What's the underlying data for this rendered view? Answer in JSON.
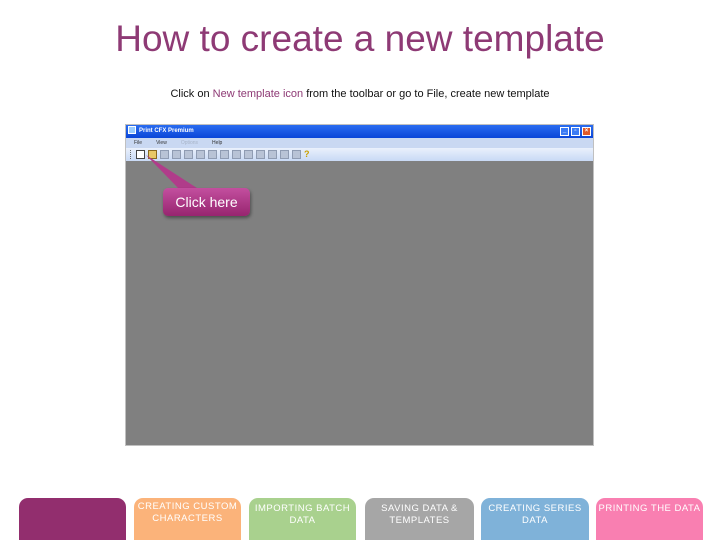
{
  "title": "How to create a new template",
  "subtitle": {
    "prefix": "Click on ",
    "highlight": "New template icon",
    "suffix": " from the toolbar or go to File, create new template"
  },
  "app_window": {
    "title": "Print CFX Premium",
    "menu": [
      "File",
      "View",
      "Options",
      "Help"
    ],
    "window_buttons": [
      "minimize",
      "restore",
      "close"
    ],
    "toolbar_icons": [
      "new-template-icon",
      "open-icon",
      "save-icon",
      "print-icon",
      "tool-icon",
      "tool-icon",
      "tool-icon",
      "tool-icon",
      "tool-icon",
      "tool-icon",
      "tool-icon",
      "tool-icon",
      "tool-icon",
      "tool-icon",
      "help-icon"
    ]
  },
  "callout": {
    "label": "Click here"
  },
  "colors": {
    "brand": "#8e3a75",
    "nav_active": "#922e6e",
    "nav_custom": "#fbb37a",
    "nav_batch": "#a9d18e",
    "nav_saving": "#a6a6a6",
    "nav_series": "#7fb2d9",
    "nav_printing": "#f97fb1"
  },
  "nav": [
    {
      "label": "",
      "color": "#922e6e"
    },
    {
      "label": "CREATING CUSTOM CHARACTERS",
      "color": "#fbb37a"
    },
    {
      "label": "IMPORTING BATCH DATA",
      "color": "#a9d18e"
    },
    {
      "label": "SAVING DATA & TEMPLATES",
      "color": "#a6a6a6"
    },
    {
      "label": "CREATING SERIES DATA",
      "color": "#7fb2d9"
    },
    {
      "label": "PRINTING THE DATA",
      "color": "#f97fb1"
    }
  ]
}
